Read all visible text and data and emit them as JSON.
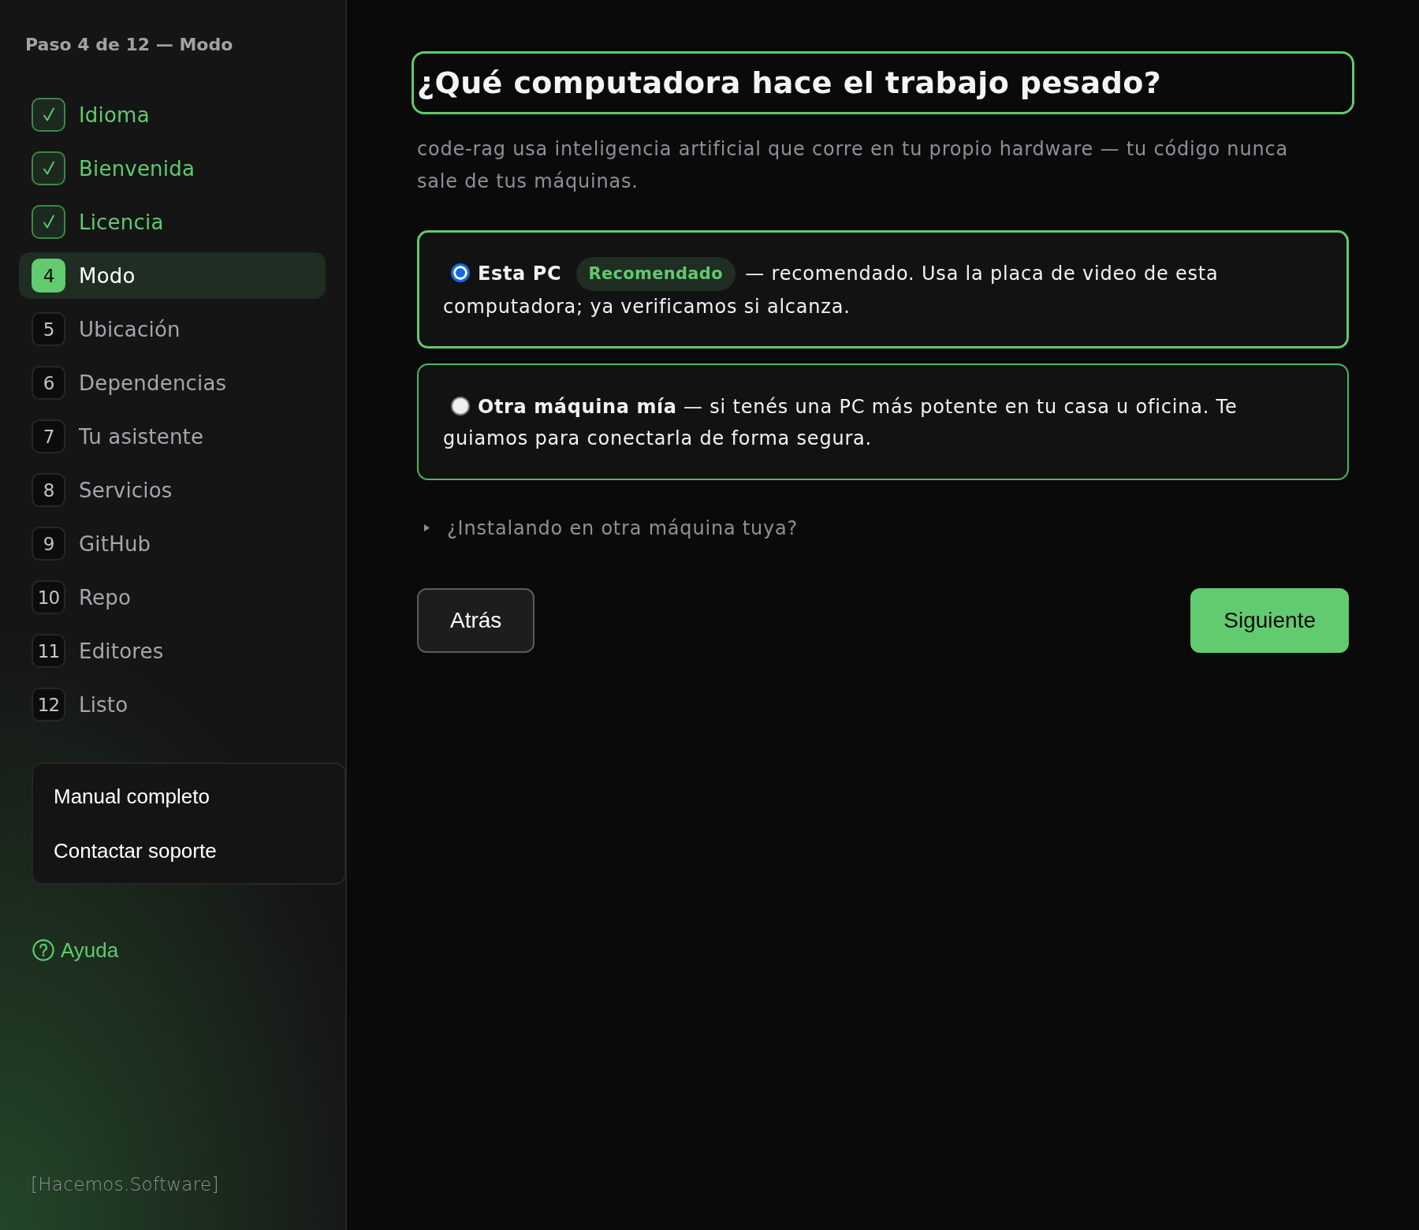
{
  "sidebar": {
    "progress_label": "Paso 4 de 12 — Modo",
    "steps": [
      {
        "label": "Idioma",
        "completed": true,
        "selected": false
      },
      {
        "label": "Bienvenida",
        "completed": true,
        "selected": false
      },
      {
        "label": "Licencia",
        "completed": true,
        "selected": false
      },
      {
        "number": "4",
        "label": "Modo",
        "completed": false,
        "selected": true
      },
      {
        "number": "5",
        "label": "Ubicación",
        "completed": false,
        "selected": false
      },
      {
        "number": "6",
        "label": "Dependencias",
        "completed": false,
        "selected": false
      },
      {
        "number": "7",
        "label": "Tu asistente",
        "completed": false,
        "selected": false
      },
      {
        "number": "8",
        "label": "Servicios",
        "completed": false,
        "selected": false
      },
      {
        "number": "9",
        "label": "GitHub",
        "completed": false,
        "selected": false
      },
      {
        "number": "10",
        "label": "Repo",
        "completed": false,
        "selected": false
      },
      {
        "number": "11",
        "label": "Editores",
        "completed": false,
        "selected": false
      },
      {
        "number": "12",
        "label": "Listo",
        "completed": false,
        "selected": false
      }
    ],
    "links": [
      {
        "label": "Manual completo"
      },
      {
        "label": "Contactar soporte"
      }
    ],
    "help": {
      "label": "Ayuda"
    },
    "footer_logo": {
      "before": "[Hacemos",
      "accent": ".",
      "after": "Software]"
    }
  },
  "main": {
    "title": {
      "text": "¿Qué computadora hace el trabajo pesado?",
      "focused": true
    },
    "subtitle": "code-rag usa inteligencia artificial que corre en tu propio hardware — tu código nunca sale de tus máquinas.",
    "options": [
      {
        "title": "Esta PC",
        "badge": "Recomendado",
        "description": "— recomendado. Usa la placa de video de esta computadora; ya verificamos si alcanza.",
        "selected": true
      },
      {
        "title": "Otra máquina mía",
        "description": "— si tenés una PC más potente en tu casa u oficina. Te guiamos para conectarla de forma segura.",
        "selected": false
      }
    ],
    "disclosure": {
      "label": "¿Instalando en otra máquina tuya?",
      "expanded": false
    },
    "buttons": [
      {
        "label": "Atrás",
        "kind": "secondary"
      },
      {
        "label": "Siguiente",
        "kind": "primary"
      }
    ]
  }
}
